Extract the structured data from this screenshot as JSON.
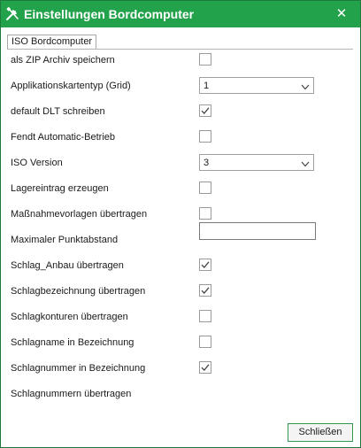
{
  "window": {
    "title": "Einstellungen Bordcomputer",
    "icon": "settings-tools-icon",
    "close_glyph": "✕",
    "accent": "#22a24a"
  },
  "tab": {
    "label": "ISO Bordcomputer"
  },
  "settings": [
    {
      "label": "als ZIP Archiv speichern",
      "control": "checkbox",
      "checked": false
    },
    {
      "label": "Applikationskartentyp (Grid)",
      "control": "select",
      "value": "1"
    },
    {
      "label": "default DLT schreiben",
      "control": "checkbox",
      "checked": true
    },
    {
      "label": "Fendt Automatic-Betrieb",
      "control": "checkbox",
      "checked": false
    },
    {
      "label": "ISO Version",
      "control": "select",
      "value": "3"
    },
    {
      "label": "Lagereintrag erzeugen",
      "control": "checkbox",
      "checked": false
    },
    {
      "label": "Maßnahmevorlagen übertragen",
      "control": "checkbox",
      "checked": false
    },
    {
      "label": "Maximaler Punktabstand",
      "control": "text",
      "value": ""
    },
    {
      "label": "Schlag_Anbau übertragen",
      "control": "checkbox",
      "checked": true
    },
    {
      "label": "Schlagbezeichnung übertragen",
      "control": "checkbox",
      "checked": true
    },
    {
      "label": "Schlagkonturen übertragen",
      "control": "checkbox",
      "checked": false
    },
    {
      "label": "Schlagname in Bezeichnung",
      "control": "checkbox",
      "checked": false
    },
    {
      "label": "Schlagnummer in Bezeichnung",
      "control": "checkbox",
      "checked": true
    },
    {
      "label": "Schlagnummern übertragen",
      "control": "none"
    }
  ],
  "footer": {
    "close_label": "Schließen"
  }
}
